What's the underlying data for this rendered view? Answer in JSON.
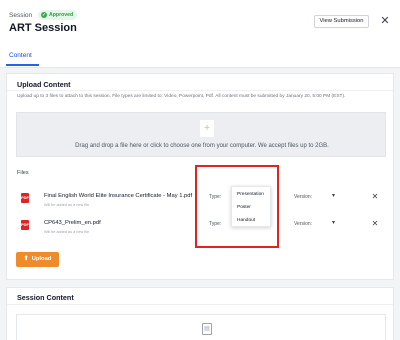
{
  "header": {
    "breadcrumb": "Session",
    "status_badge": "Approved",
    "title": "ART Session",
    "view_submission_label": "View Submission",
    "close_glyph": "✕"
  },
  "tabs": [
    {
      "label": "Content",
      "active": true
    }
  ],
  "upload_content": {
    "title": "Upload Content",
    "description": "Upload up to 3 files to attach to this session. File types are limited to: Video, Powerpoint, Pdf. All content must be submitted by January 20, 5:00 PM (EST).",
    "dropzone_text": "Drag and drop a file here or click to choose one from your computer. We accept files up to 2GB.",
    "dropzone_icon": "plus-icon",
    "files_label": "Files",
    "files": [
      {
        "name": "Final English World Elite Insurance Certificate - May 1.pdf",
        "note": "Will be added as a new file",
        "type_label": "Type:",
        "version_label": "Version:",
        "icon": "pdf-file-icon"
      },
      {
        "name": "CP643_Prelim_en.pdf",
        "note": "Will be added as a new file",
        "type_label": "Type:",
        "version_label": "Version:",
        "icon": "pdf-file-icon"
      }
    ],
    "type_options": [
      "Presentation",
      "Poster",
      "Handout"
    ],
    "upload_button_label": "Upload",
    "upload_icon": "upload-arrow-icon"
  },
  "session_content": {
    "title": "Session Content",
    "icon": "document-icon"
  },
  "colors": {
    "accent_blue": "#2563eb",
    "badge_green": "#2f9e44",
    "upload_orange": "#f08b2b",
    "highlight_red": "#e02424",
    "pdf_red": "#e02424"
  }
}
